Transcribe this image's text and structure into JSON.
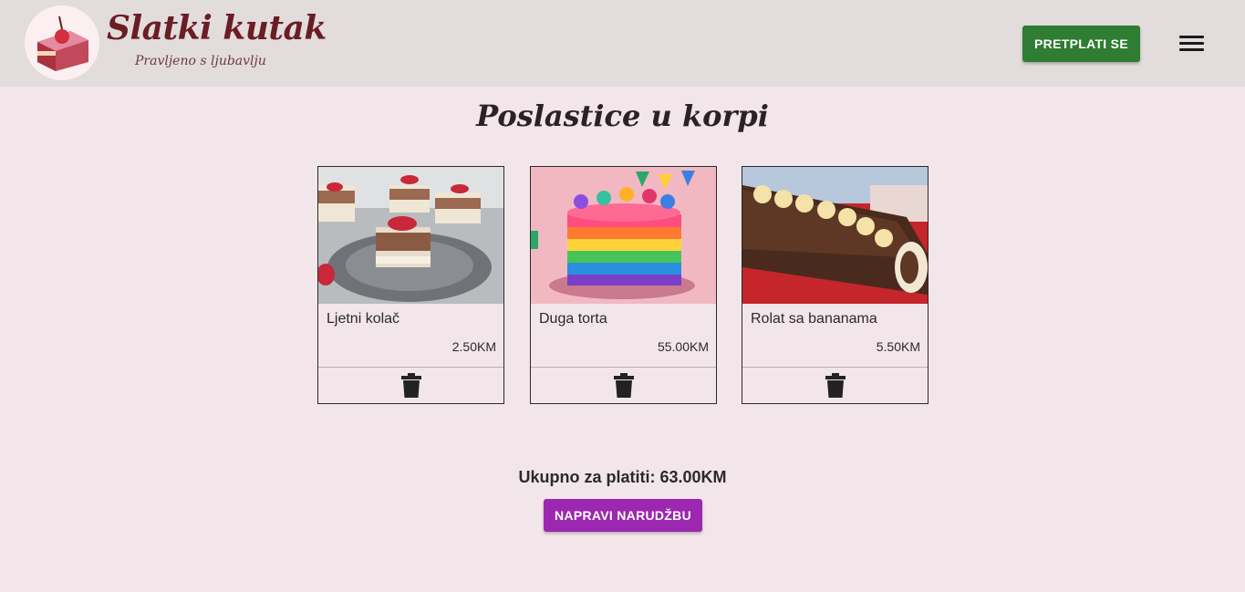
{
  "brand": {
    "title": "Slatki kutak",
    "subtitle": "Pravljeno s ljubavlju"
  },
  "header": {
    "subscribe_label": "PRETPLATI SE",
    "menu_icon": "hamburger-menu-icon"
  },
  "page": {
    "title": "Poslastice u korpi"
  },
  "cart": {
    "items": [
      {
        "name": "Ljetni kolač",
        "price": "2.50KM"
      },
      {
        "name": "Duga torta",
        "price": "55.00KM"
      },
      {
        "name": "Rolat sa bananama",
        "price": "5.50KM"
      }
    ],
    "remove_icon": "trash-icon",
    "total_text": "Ukupno za platiti: 63.00KM",
    "order_label": "NAPRAVI NARUDŽBU"
  },
  "colors": {
    "header_bg": "#e2dcdd",
    "page_bg": "#f3e6ea",
    "brand": "#6b1d24",
    "subscribe_button": "#2e7d32",
    "order_button": "#9c27b0"
  }
}
